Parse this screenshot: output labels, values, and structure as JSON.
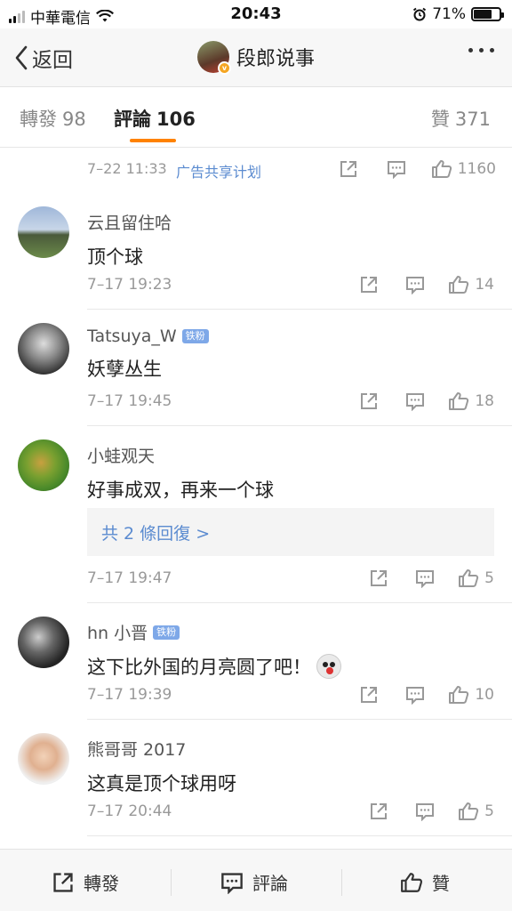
{
  "status_bar": {
    "carrier": "中華電信",
    "time": "20:43",
    "battery": "71%",
    "battery_level": 0.71
  },
  "nav": {
    "back_label": "返回",
    "title": "段郎说事"
  },
  "tabs": {
    "repost": {
      "label": "轉發",
      "count": "98"
    },
    "comments": {
      "label": "評論",
      "count": "106"
    },
    "likes": {
      "label": "贊",
      "count": "371"
    }
  },
  "post_meta": {
    "time": "7–22 11:33",
    "ad_link": "广告共享计划",
    "like_count": "1160"
  },
  "comments": [
    {
      "name": "云且留住哈",
      "text": "顶个球",
      "time": "7–17 19:23",
      "likes": "14"
    },
    {
      "name": "Tatsuya_W",
      "badge": "铁粉",
      "text": "妖孽丛生",
      "time": "7–17 19:45",
      "likes": "18"
    },
    {
      "name": "小蛙观天",
      "text": "好事成双，再来一个球",
      "replies": "共 2 條回復 >",
      "time": "7–17 19:47",
      "likes": "5"
    },
    {
      "name": "hn 小晋",
      "badge": "铁粉",
      "text": "这下比外国的月亮圆了吧！",
      "time": "7–17 19:39",
      "likes": "10"
    },
    {
      "name": "熊哥哥 2017",
      "text": "这真是顶个球用呀",
      "time": "7–17 20:44",
      "likes": "5"
    }
  ],
  "bottom_bar": {
    "repost": "轉發",
    "comment": "評論",
    "like": "贊"
  }
}
